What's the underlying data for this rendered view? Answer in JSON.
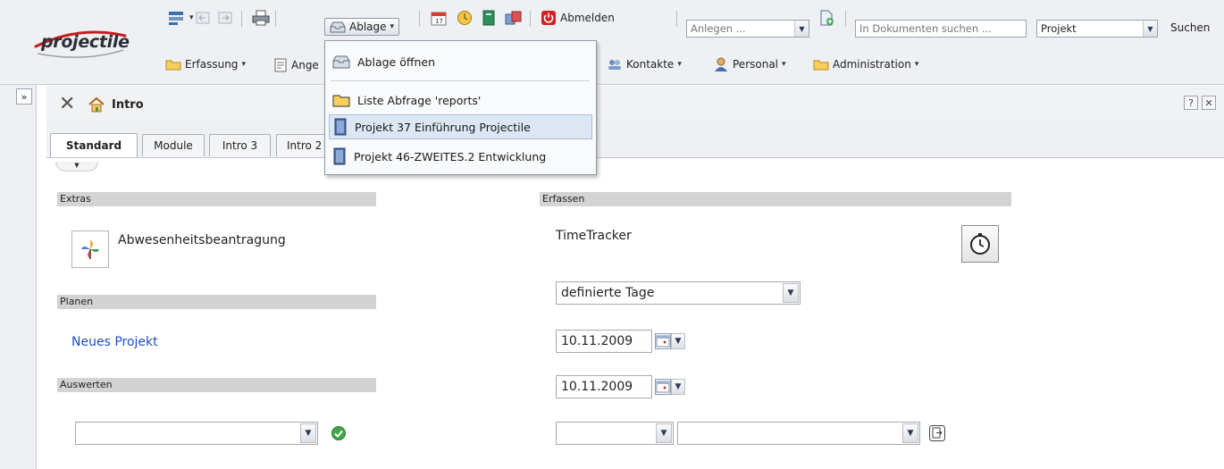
{
  "app": {
    "logo_text": "projectile"
  },
  "toolbar": {
    "ablage_label": "Ablage",
    "abmelden_label": "Abmelden",
    "anlegen_placeholder": "Anlegen ...",
    "search_placeholder": "In Dokumenten suchen ...",
    "search_scope_value": "Projekt",
    "search_button_label": "Suchen"
  },
  "nav_menu": {
    "erfassung": "Erfassung",
    "angebote_partial": "Ange",
    "kontakte": "Kontakte",
    "personal": "Personal",
    "administration": "Administration"
  },
  "ablage_menu": {
    "items": [
      {
        "label": "Ablage öffnen",
        "icon": "folder-open-icon"
      },
      {
        "label": "Liste Abfrage 'reports'",
        "icon": "folder-icon"
      },
      {
        "label": "Projekt 37 Einführung Projectile",
        "icon": "project-book-icon"
      },
      {
        "label": "Projekt 46-ZWEITES.2 Entwicklung",
        "icon": "project-book-icon"
      }
    ]
  },
  "panel": {
    "title": "Intro",
    "help_label": "?",
    "tabs": [
      {
        "label": "Standard"
      },
      {
        "label": "Module"
      },
      {
        "label": "Intro 3"
      },
      {
        "label": "Intro 2"
      }
    ]
  },
  "sections": {
    "extras": "Extras",
    "erfassen": "Erfassen",
    "planen": "Planen",
    "auswerten": "Auswerten"
  },
  "content": {
    "abwesenheit_label": "Abwesenheitsbeantragung",
    "timetracker_label": "TimeTracker",
    "neues_projekt_link": "Neues Projekt",
    "period_select_value": "definierte Tage",
    "date_from": "10.11.2009",
    "date_to": "10.11.2009"
  },
  "colors": {
    "link": "#1f4fbf",
    "section_bar": "#d3d3d3",
    "menu_highlight": "#dde7f3",
    "abmelden_red": "#d42020"
  }
}
